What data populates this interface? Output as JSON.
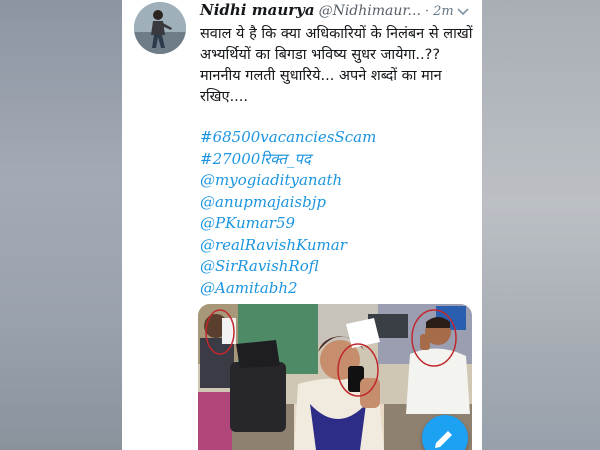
{
  "tweet": {
    "name": "Nidhi maurya",
    "handle": "@Nidhimaur...",
    "time": "· 2m",
    "text_lines": [
      "सवाल ये है कि क्या अधिकारियों के निलंबन से लाखों अभ्यर्थियों का बिगडा भविष्य सुधर जायेगा..??",
      "माननीय गलती सुधारिये... अपने शब्दों का मान रखिए...."
    ],
    "tags": [
      "#68500vacanciesScam",
      "#27000रिक्त_पद",
      "@myogiadityanath",
      "@anupmajaisbjp",
      "@PKumar59",
      "@realRavishKumar",
      "@SirRavishRofl",
      "@Aamitabh2"
    ]
  },
  "icons": {
    "chevron": "chevron-down-icon",
    "compose": "compose-icon"
  },
  "colors": {
    "link": "#1b95e0",
    "fab": "#1da1f2"
  }
}
